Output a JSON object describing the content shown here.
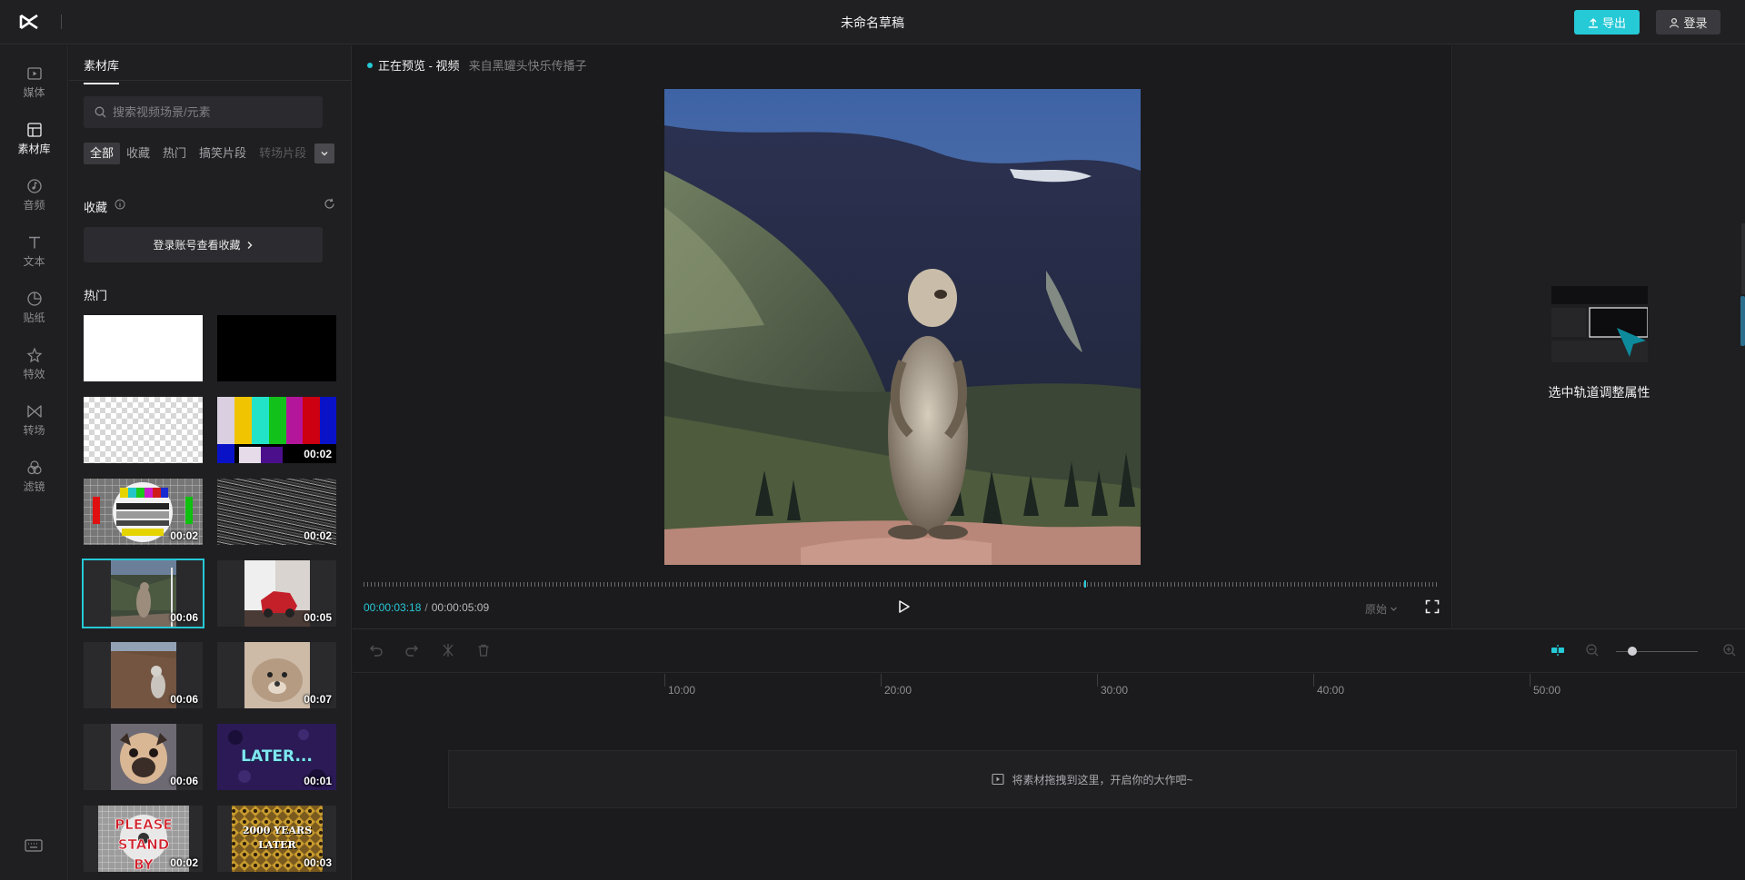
{
  "header": {
    "title": "未命名草稿",
    "export_label": "导出",
    "login_label": "登录"
  },
  "nav": {
    "items": [
      {
        "label": "媒体",
        "icon": "media-icon"
      },
      {
        "label": "素材库",
        "icon": "library-icon"
      },
      {
        "label": "音频",
        "icon": "audio-icon"
      },
      {
        "label": "文本",
        "icon": "text-icon"
      },
      {
        "label": "贴纸",
        "icon": "sticker-icon"
      },
      {
        "label": "特效",
        "icon": "effects-icon"
      },
      {
        "label": "转场",
        "icon": "transition-icon"
      },
      {
        "label": "滤镜",
        "icon": "filter-icon"
      }
    ],
    "active": "素材库"
  },
  "library": {
    "tab": "素材库",
    "search_placeholder": "搜索视频场景/元素",
    "filters": [
      "全部",
      "收藏",
      "热门",
      "搞笑片段",
      "转场片段"
    ],
    "active_filter": "全部",
    "favorites_title": "收藏",
    "favorites_login": "登录账号查看收藏",
    "hot_title": "热门",
    "thumbnails": [
      {
        "kind": "white",
        "duration": ""
      },
      {
        "kind": "black",
        "duration": ""
      },
      {
        "kind": "transparent",
        "duration": ""
      },
      {
        "kind": "color-bars",
        "duration": "00:02"
      },
      {
        "kind": "test-card",
        "duration": "00:02"
      },
      {
        "kind": "static-noise",
        "duration": "00:02"
      },
      {
        "kind": "marmot",
        "duration": "00:06",
        "selected": true
      },
      {
        "kind": "toy-car",
        "duration": "00:05"
      },
      {
        "kind": "dog-field",
        "duration": "00:06"
      },
      {
        "kind": "puppy",
        "duration": "00:07"
      },
      {
        "kind": "pug",
        "duration": "00:06"
      },
      {
        "kind": "later-text",
        "duration": "00:01",
        "text": "LATER..."
      },
      {
        "kind": "stand-by",
        "duration": "00:02",
        "text": "PLEASE STAND BY"
      },
      {
        "kind": "years-later",
        "duration": "00:03",
        "text": "2000 YEARS LATER"
      }
    ]
  },
  "preview": {
    "status": "正在预览 - 视频",
    "source": "来自黑罐头快乐传播子",
    "current_time": "00:00:03:18",
    "total_time": "00:00:05:09",
    "progress": 0.67,
    "ratio_label": "原始"
  },
  "properties": {
    "hint": "选中轨道调整属性"
  },
  "timeline": {
    "ticks": [
      "10:00",
      "20:00",
      "30:00",
      "40:00",
      "50:00"
    ],
    "drop_hint": "将素材拖拽到这里，开启你的大作吧~",
    "zoom_level": 0.2
  },
  "colors": {
    "accent": "#26c9d6"
  }
}
